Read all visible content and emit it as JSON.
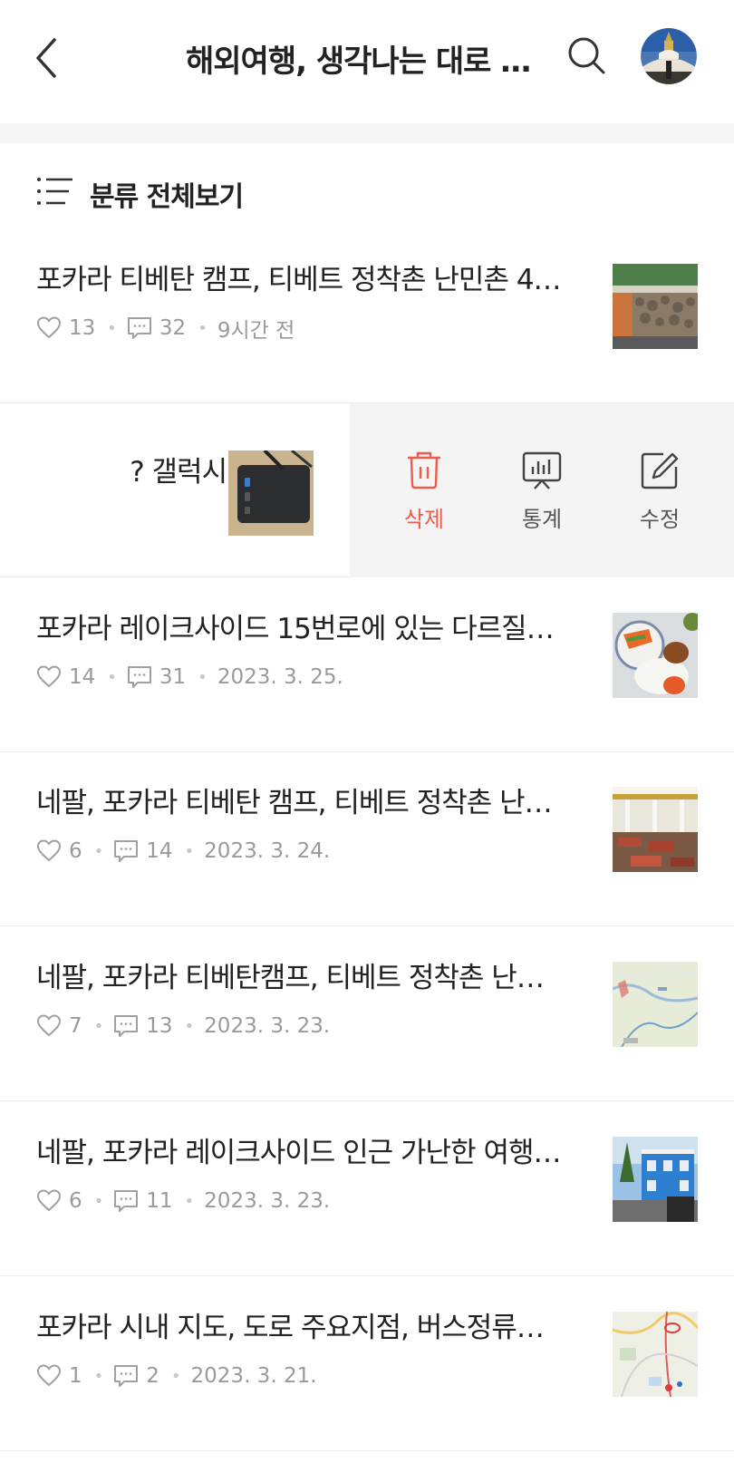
{
  "header": {
    "title": "해외여행, 생각나는 대로 …",
    "back_icon": "chevron-left-icon",
    "search_icon": "search-icon"
  },
  "category": {
    "label": "분류 전체보기",
    "icon": "list-icon"
  },
  "swiped_post": {
    "title": "? 갤럭시핏 충…",
    "actions": [
      {
        "label": "삭제",
        "icon": "trash-icon",
        "color": "#f05a4a"
      },
      {
        "label": "통계",
        "icon": "stats-icon",
        "color": "#555555"
      },
      {
        "label": "수정",
        "icon": "edit-icon",
        "color": "#555555"
      }
    ]
  },
  "posts": [
    {
      "title": "포카라 티베탄 캠프, 티베트 정착촌 난민촌 4…",
      "likes": "13",
      "comments": "32",
      "date": "9시간 전"
    },
    {
      "title": "포카라 레이크사이드 15번로에 있는 다르질…",
      "likes": "14",
      "comments": "31",
      "date": "2023. 3. 25."
    },
    {
      "title": "네팔, 포카라 티베탄 캠프, 티베트 정착촌 난…",
      "likes": "6",
      "comments": "14",
      "date": "2023. 3. 24."
    },
    {
      "title": "네팔, 포카라 티베탄캠프, 티베트 정착촌 난…",
      "likes": "7",
      "comments": "13",
      "date": "2023. 3. 23."
    },
    {
      "title": "네팔, 포카라 레이크사이드 인근 가난한 여행…",
      "likes": "6",
      "comments": "11",
      "date": "2023. 3. 23."
    },
    {
      "title": "포카라 시내 지도, 도로 주요지점, 버스정류…",
      "likes": "1",
      "comments": "2",
      "date": "2023. 3. 21."
    }
  ],
  "colors": {
    "accent_delete": "#f05a4a",
    "text_primary": "#222222",
    "text_meta": "#9a9a9a",
    "action_bg": "#f4f4f4"
  }
}
